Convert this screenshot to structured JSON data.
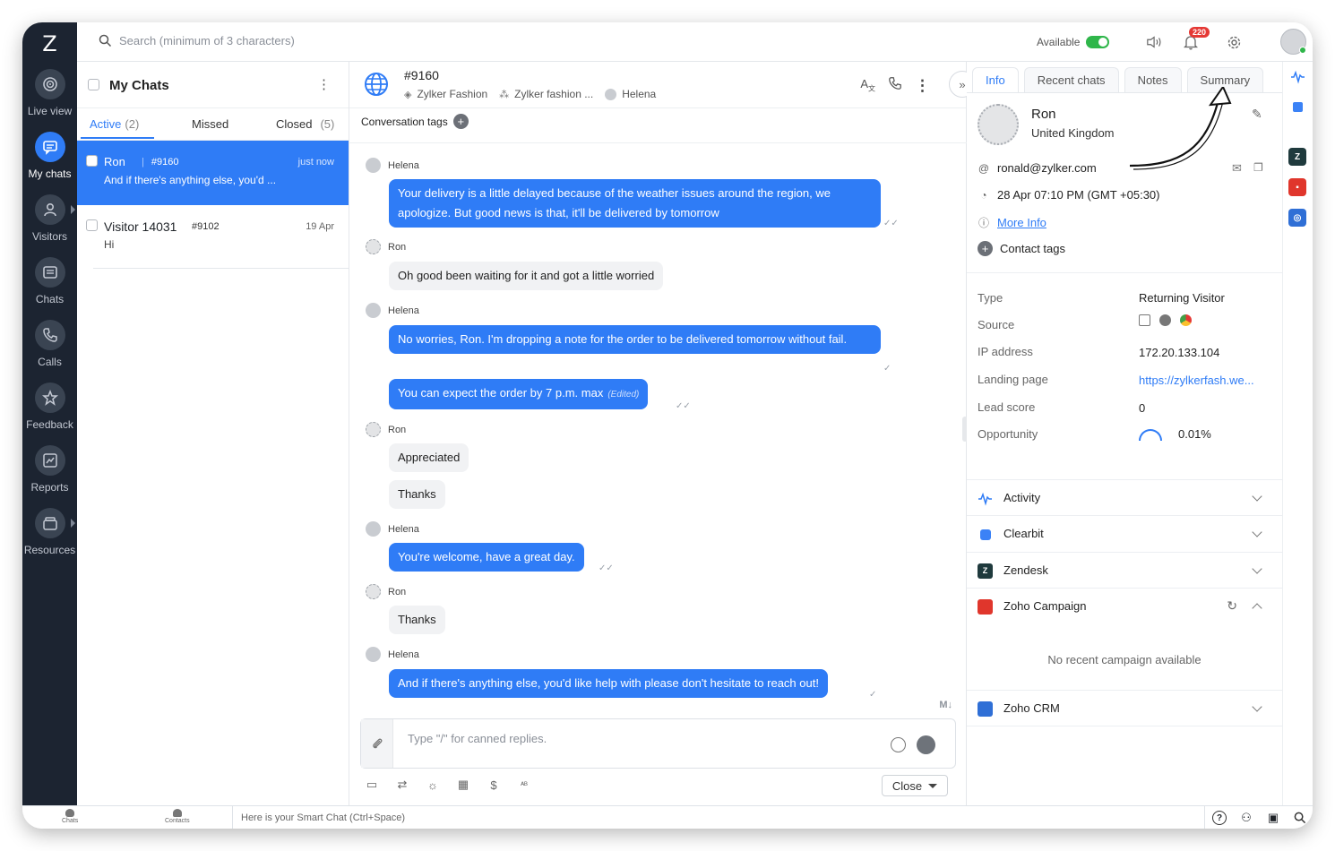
{
  "app": {
    "logo": "Z"
  },
  "rail": {
    "items": [
      {
        "label": "Live view",
        "icon": "live-view-icon"
      },
      {
        "label": "My chats",
        "icon": "chat-bubble-icon",
        "active": true
      },
      {
        "label": "Visitors",
        "icon": "person-icon"
      },
      {
        "label": "Chats",
        "icon": "chats-icon"
      },
      {
        "label": "Calls",
        "icon": "phone-icon"
      },
      {
        "label": "Feedback",
        "icon": "star-icon"
      },
      {
        "label": "Reports",
        "icon": "chart-icon"
      },
      {
        "label": "Resources",
        "icon": "box-icon"
      }
    ]
  },
  "topbar": {
    "search_placeholder": "Search (minimum of 3 characters)",
    "availability": "Available",
    "notification_count": "220",
    "accent": "#2f7cf6",
    "status_color": "#2fb64a"
  },
  "chatlist": {
    "title": "My Chats",
    "tabs": [
      {
        "label": "Active",
        "count": "(2)"
      },
      {
        "label": "Missed",
        "count": ""
      },
      {
        "label": "Closed",
        "count": "(5)"
      }
    ],
    "conversations": [
      {
        "name": "Ron",
        "id": "#9160",
        "time": "just now",
        "preview": "And if there's anything else, you'd ..."
      },
      {
        "name": "Visitor 14031",
        "id": "#9102",
        "time": "19 Apr",
        "preview": "Hi"
      }
    ]
  },
  "chat": {
    "id": "#9160",
    "brand": "Zylker Fashion",
    "department": "Zylker fashion ...",
    "agent": "Helena",
    "conversation_tags_label": "Conversation tags",
    "messages": [
      {
        "sender": "Helena",
        "text": "Your delivery is a little delayed because of the weather issues around the region, we apologize. But good news is that, it'll be delivered by tomorrow"
      },
      {
        "sender": "Ron",
        "text": "Oh good been waiting for it and got a little worried"
      },
      {
        "sender": "Helena",
        "text": "No worries, Ron. I'm dropping a note for the order to be delivered tomorrow without fail."
      },
      {
        "sender": "",
        "text": "You can expect the order by 7 p.m. max",
        "edited": "(Edited)"
      },
      {
        "sender": "Ron",
        "text": "Appreciated"
      },
      {
        "sender": "",
        "text": "Thanks"
      },
      {
        "sender": "Helena",
        "text": "You're welcome, have a great day."
      },
      {
        "sender": "Ron",
        "text": "Thanks"
      },
      {
        "sender": "Helena",
        "text": "And if there's anything else, you'd like help with please don't hesitate to reach out!"
      }
    ],
    "markdown_label": "M↓",
    "composer_placeholder": "Type \"/\" for canned replies.",
    "close_label": "Close"
  },
  "panel": {
    "tabs": [
      "Info",
      "Recent chats",
      "Notes",
      "Summary"
    ],
    "contact": {
      "name": "Ron",
      "country": "United Kingdom",
      "email": "ronald@zylker.com",
      "datetime": "28 Apr 07:10 PM  (GMT +05:30)",
      "more_info": "More Info",
      "contact_tags": "Contact tags"
    },
    "details": [
      {
        "key": "Type",
        "value": "Returning Visitor"
      },
      {
        "key": "Source",
        "value": ""
      },
      {
        "key": "IP address",
        "value": "172.20.133.104"
      },
      {
        "key": "Landing page",
        "value": "https://zylkerfash.we..."
      },
      {
        "key": "Lead score",
        "value": "0"
      },
      {
        "key": "Opportunity",
        "value": "0.01%"
      }
    ],
    "sections": [
      {
        "label": "Activity",
        "color": "#2f7cf6"
      },
      {
        "label": "Clearbit",
        "color": "#3b82f6"
      },
      {
        "label": "Zendesk",
        "color": "#1f3a3d"
      },
      {
        "label": "Zoho Campaign",
        "color": "#e0362c"
      },
      {
        "label": "Zoho CRM",
        "color": "#2f6fd6"
      }
    ],
    "no_campaign": "No recent campaign available"
  },
  "bottombar": {
    "chats_label": "Chats",
    "contacts_label": "Contacts",
    "smart_chat": "Here is your Smart Chat (Ctrl+Space)"
  }
}
